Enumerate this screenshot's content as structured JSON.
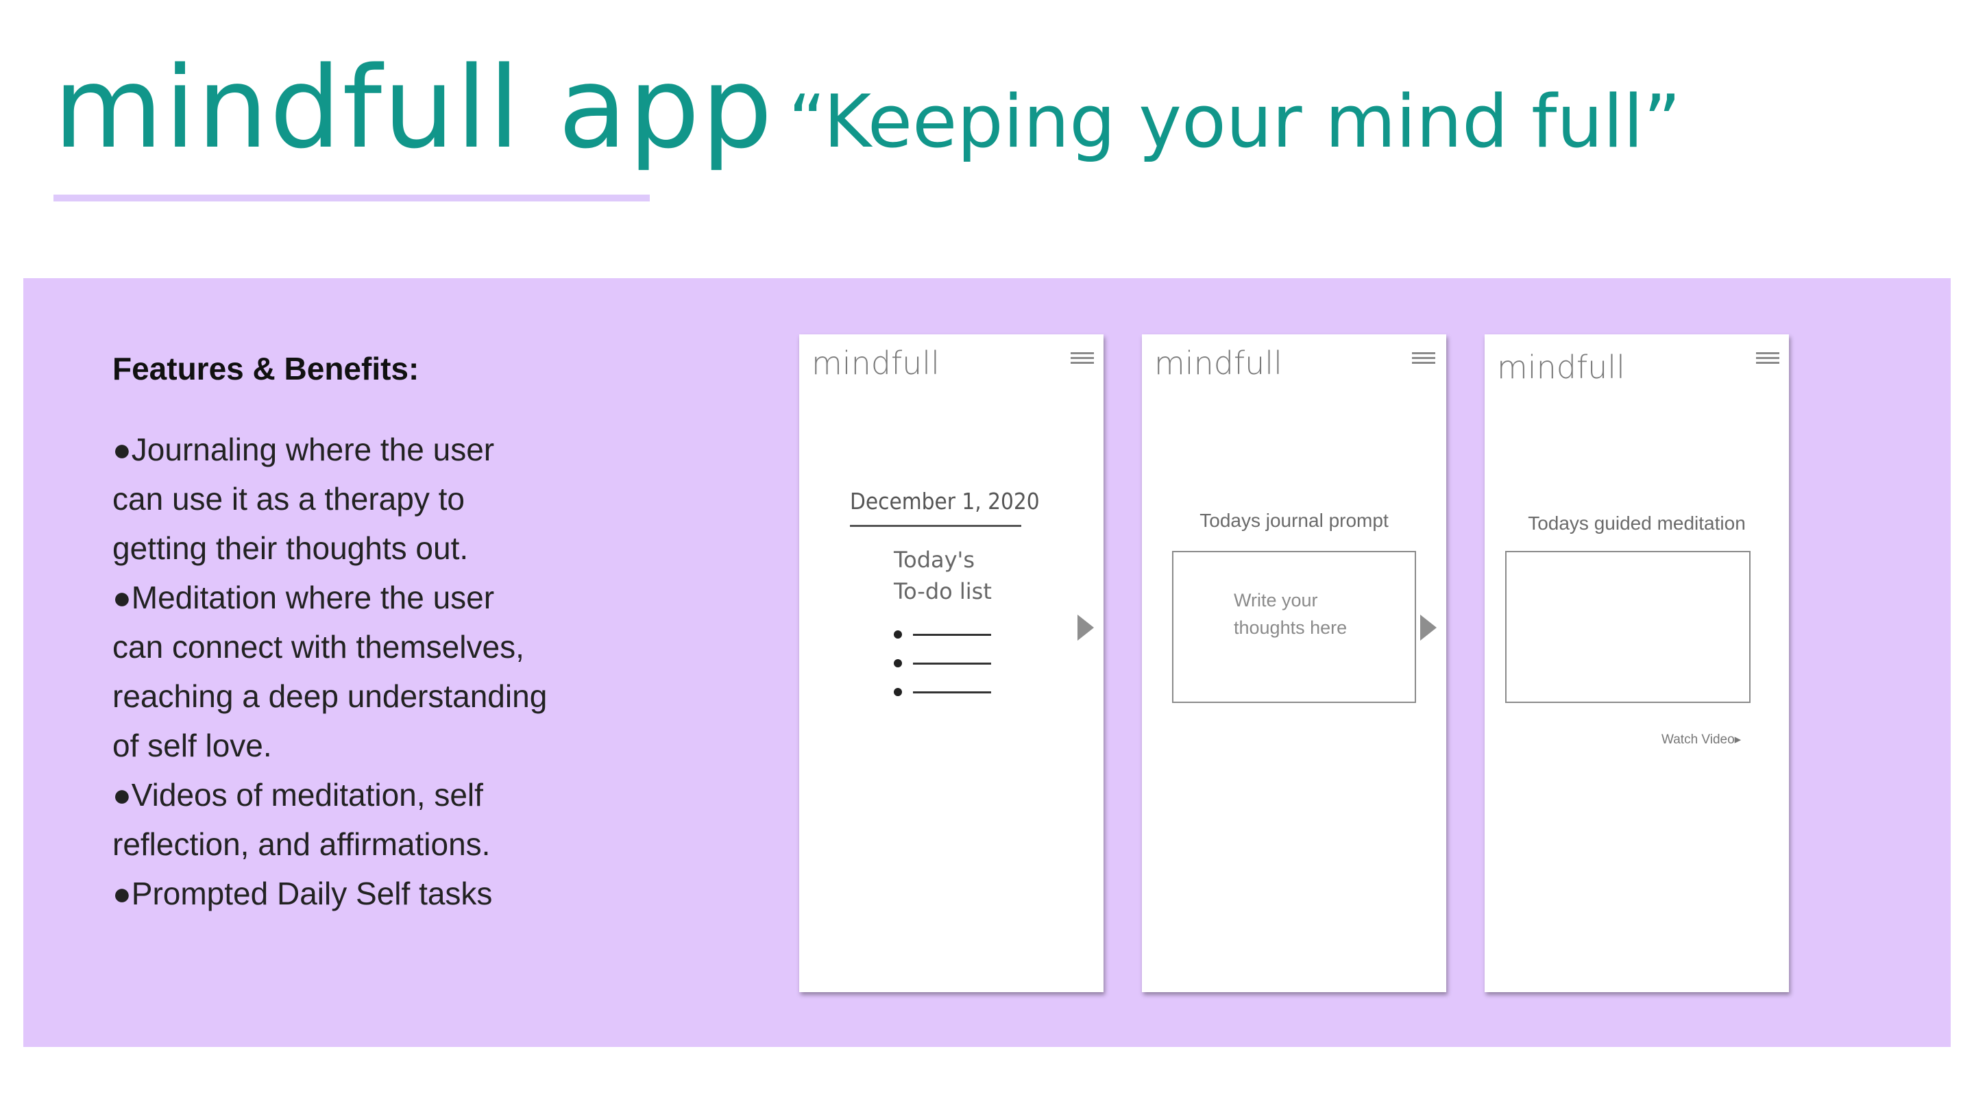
{
  "header": {
    "app_title": "mindfull app",
    "tagline": "“Keeping your mind full”"
  },
  "features": {
    "heading": "Features & Benefits:",
    "lines": [
      "●Journaling where the user",
      "can use it as a therapy to",
      "getting their thoughts out.",
      "●Meditation  where the user",
      "can connect with themselves,",
      "reaching a deep understanding",
      "of self love.",
      "●Videos of meditation, self",
      "reflection, and affirmations.",
      "●Prompted Daily Self tasks"
    ]
  },
  "mockups": {
    "brand": "mindfull",
    "screen1": {
      "date": "December 1, 2020",
      "todo_heading": "Today's\nTo-do list",
      "todo_item_count_visible": 3
    },
    "screen2": {
      "prompt_label": "Todays journal prompt",
      "placeholder": "Write your\nthoughts here"
    },
    "screen3": {
      "meditation_label": "Todays guided meditation",
      "watch_video": "Watch Video▸"
    }
  },
  "colors": {
    "accent_teal": "#11968a",
    "panel_lavender": "#e1c6fc",
    "underline_lavender": "#dec9fb"
  },
  "icons": [
    "menu-icon",
    "next-arrow-icon",
    "bullet-icon"
  ]
}
